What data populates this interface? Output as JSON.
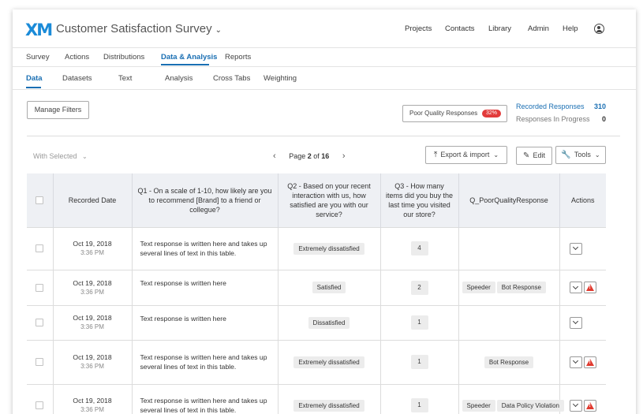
{
  "header": {
    "logo": "XM",
    "survey_title": "Customer Satisfaction Survey",
    "nav": [
      "Projects",
      "Contacts",
      "Library",
      "Admin",
      "Help"
    ]
  },
  "tabs_primary": [
    "Survey",
    "Actions",
    "Distributions",
    "Data & Analysis",
    "Reports"
  ],
  "tabs_primary_active": "Data & Analysis",
  "tabs_secondary": [
    "Data",
    "Datasets",
    "Text",
    "Analysis",
    "Cross Tabs",
    "Weighting"
  ],
  "tabs_secondary_active": "Data",
  "toolbar": {
    "manage_filters": "Manage Filters",
    "pqr_label": "Poor Quality Responses",
    "pqr_badge": "32%",
    "recorded_label": "Recorded Responses",
    "recorded_value": "310",
    "in_progress_label": "Responses In Progress",
    "in_progress_value": "0",
    "with_selected": "With Selected",
    "page_label": "Page",
    "page_current": "2",
    "page_of": "of",
    "page_total": "16",
    "export": "Export & import",
    "edit": "Edit",
    "tools": "Tools"
  },
  "table": {
    "columns": [
      "Recorded Date",
      "Q1 - On a scale of 1-10, how likely are you to recommend [Brand] to a friend or collegue?",
      "Q2 - Based on your recent interaction with us, how satisfied are you with our service?",
      "Q3 - How many items did you buy the last time you visited our store?",
      "Q_PoorQualityResponse",
      "Actions"
    ],
    "rows": [
      {
        "date": "Oct 19, 2018",
        "time": "3:36 PM",
        "q1": "Text response is written here and takes up several lines of text in this table.",
        "q2": "Extremely dissatisfied",
        "q3": "4",
        "tags": [],
        "warn": false
      },
      {
        "date": "Oct 19, 2018",
        "time": "3:36 PM",
        "q1": "Text response is written here",
        "q2": "Satisfied",
        "q3": "2",
        "tags": [
          "Speeder",
          "Bot Response"
        ],
        "warn": true
      },
      {
        "date": "Oct 19, 2018",
        "time": "3:36 PM",
        "q1": "Text response is written here",
        "q2": "Dissatisfied",
        "q3": "1",
        "tags": [],
        "warn": false
      },
      {
        "date": "Oct 19, 2018",
        "time": "3:36 PM",
        "q1": "Text response is written here and takes up several lines of text in this table.",
        "q2": "Extremely dissatisfied",
        "q3": "1",
        "tags": [
          "Bot Response"
        ],
        "warn": true
      },
      {
        "date": "Oct 19, 2018",
        "time": "3:36 PM",
        "q1": "Text response is written here and takes up several lines of text in this table.",
        "q2": "Extremely dissatisfied",
        "q3": "1",
        "tags": [
          "Speeder",
          "Data Policy Violation"
        ],
        "warn": true
      }
    ]
  }
}
